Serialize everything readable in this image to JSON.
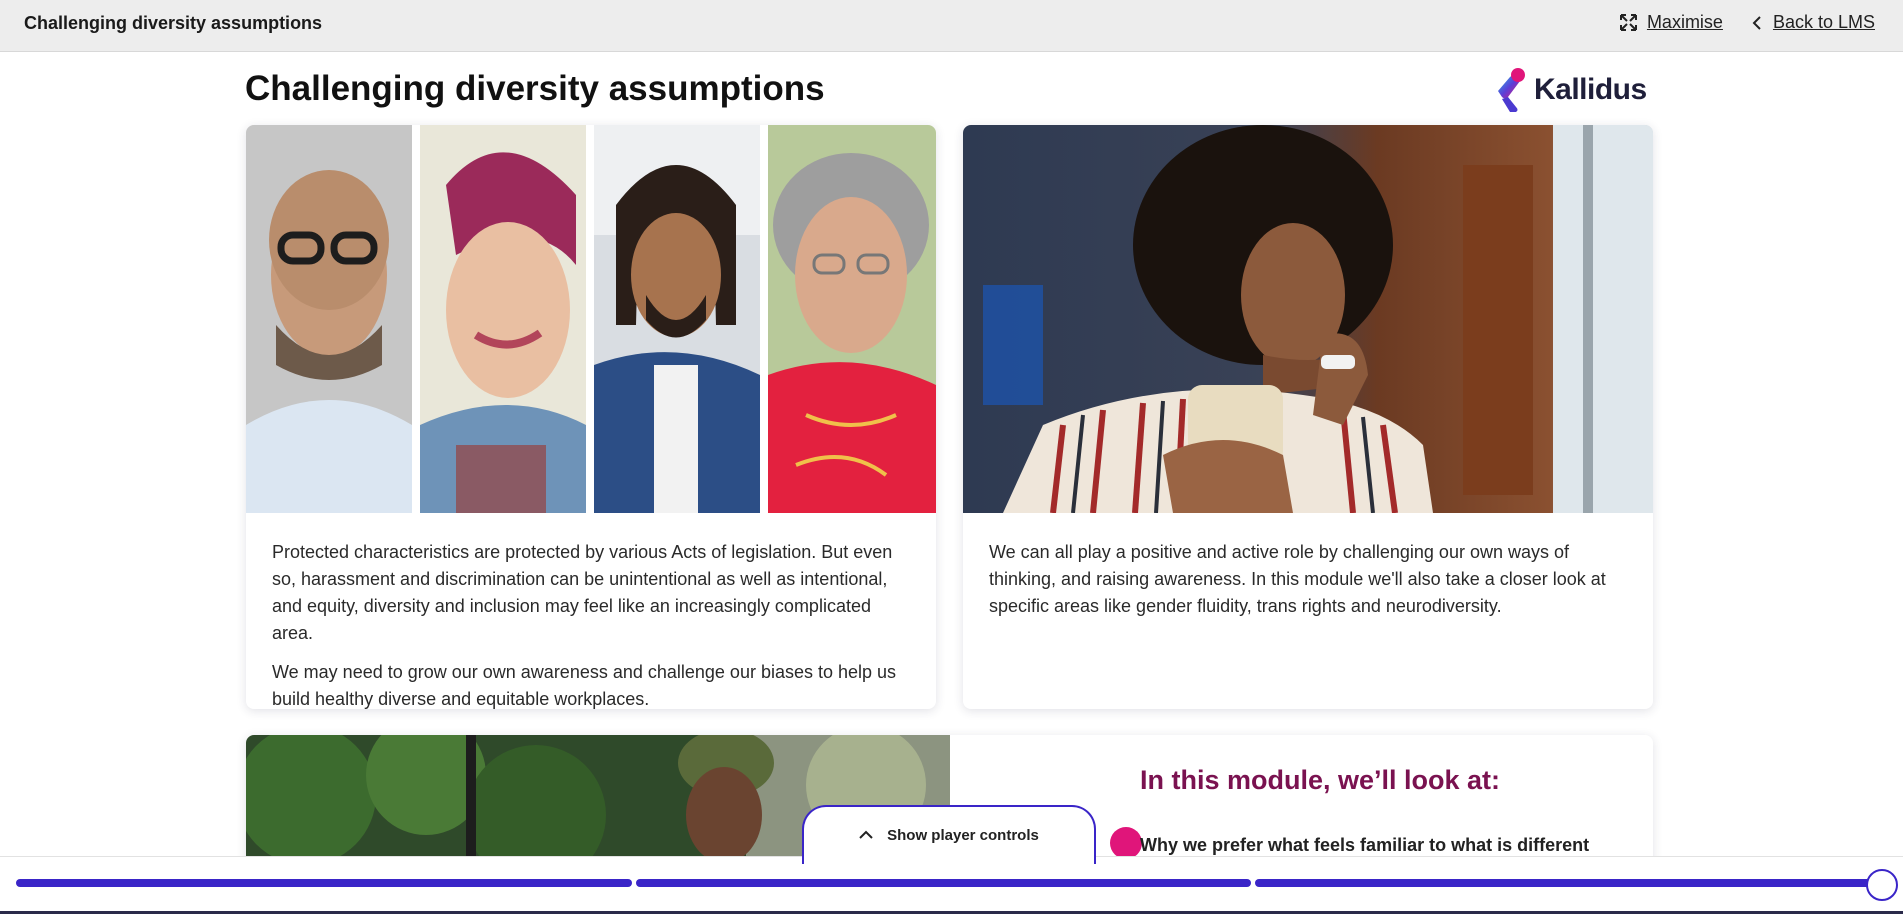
{
  "topbar": {
    "title": "Challenging diversity assumptions",
    "maximise_label": "Maximise",
    "maximise_icon": "maximise-icon",
    "back_label": "Back to LMS",
    "back_icon": "chevron-left-icon"
  },
  "main": {
    "title": "Challenging diversity assumptions",
    "logo_text": "Kallidus",
    "cards": [
      {
        "image": "four-diverse-portraits-photo",
        "paragraphs": [
          "Protected characteristics are protected by various Acts of legislation. But even so, harassment and discrimination can be unintentional as well as intentional, and equity, diversity and inclusion may feel like an increasingly complicated area.",
          "We may need to grow our own awareness and challenge our biases to help us build healthy diverse and equitable workplaces."
        ]
      },
      {
        "image": "thoughtful-woman-photo",
        "paragraphs": [
          "We can all play a positive and active role by challenging our own ways of thinking, and raising awareness. In this module we'll also take a closer look at specific areas like gender fluidity, trans rights and neurodiversity."
        ]
      }
    ],
    "module": {
      "image": "man-with-laptop-photo",
      "heading": "In this module, we’ll look at:",
      "first_item": "Why we prefer what feels familiar to what is different"
    }
  },
  "player": {
    "show_controls_label": "Show player controls",
    "show_controls_icon": "chevron-up-icon",
    "progress_fraction": 1.0,
    "progress_segments": 3
  },
  "colors": {
    "accent": "#3a25c8",
    "heading_magenta": "#7a1250",
    "brand_pink": "#e0157a"
  }
}
